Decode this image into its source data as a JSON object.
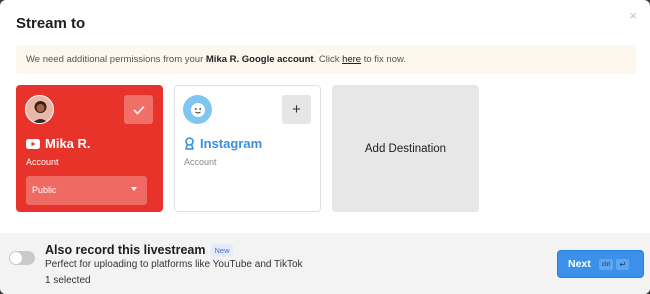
{
  "dialog": {
    "title": "Stream to",
    "close_glyph": "×"
  },
  "notice": {
    "prefix": "We need additional permissions from your ",
    "account": "Mika R. Google account",
    "middle": ". Click ",
    "link": "here",
    "suffix": " to fix now."
  },
  "destinations": {
    "youtube": {
      "name": "Mika R.",
      "type": "Account",
      "privacy": "Public",
      "selected": true,
      "icon": "youtube-icon"
    },
    "instagram": {
      "name": "Instagram",
      "type": "Account",
      "selected": false,
      "add_glyph": "+",
      "icon": "instagram-icon"
    },
    "add": {
      "label": "Add Destination"
    }
  },
  "footer": {
    "record_title": "Also record this livestream",
    "new_badge": "New",
    "record_subtitle": "Perfect for uploading to platforms like YouTube and TikTok",
    "selected_count": "1 selected",
    "toggle_on": false,
    "next_label": "Next",
    "shortcut_ctrl": "ctrl",
    "shortcut_enter": "↵"
  },
  "colors": {
    "youtube_red": "#e8332a",
    "instagram_blue": "#3b8fe0",
    "next_blue": "#3b91ea"
  }
}
